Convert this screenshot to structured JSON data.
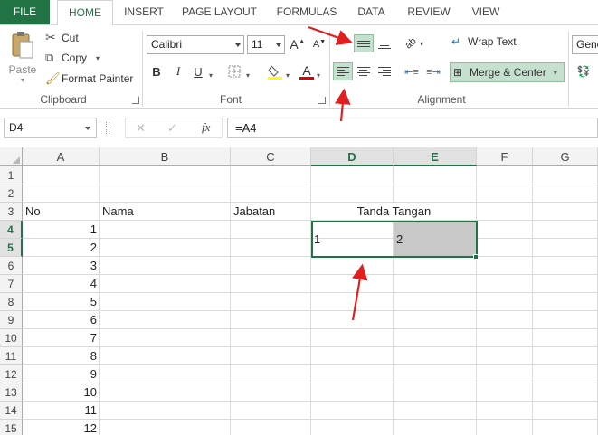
{
  "tabs": [
    "FILE",
    "HOME",
    "INSERT",
    "PAGE LAYOUT",
    "FORMULAS",
    "DATA",
    "REVIEW",
    "VIEW"
  ],
  "clipboard": {
    "paste": "Paste",
    "cut": "Cut",
    "copy": "Copy",
    "format_painter": "Format Painter",
    "label": "Clipboard"
  },
  "font": {
    "name": "Calibri",
    "size": "11",
    "label": "Font",
    "bold": "B",
    "italic": "I",
    "underline": "U",
    "grow": "A",
    "shrink": "A",
    "font_color": "A"
  },
  "alignment": {
    "wrap_text": "Wrap Text",
    "merge_center": "Merge & Center",
    "label": "Alignment"
  },
  "number": {
    "format": "Gene"
  },
  "formula_bar": {
    "name_box": "D4",
    "cancel": "✕",
    "enter": "✓",
    "fx": "fx",
    "formula": "=A4"
  },
  "columns": [
    "A",
    "B",
    "C",
    "D",
    "E",
    "F",
    "G"
  ],
  "rows": [
    "1",
    "2",
    "3",
    "4",
    "5",
    "6",
    "7",
    "8",
    "9",
    "10",
    "11",
    "12",
    "13",
    "14",
    "15"
  ],
  "cells": {
    "A3": "No",
    "B3": "Nama",
    "C3": "Jabatan",
    "D3": "Tanda Tangan",
    "A4": "1",
    "A5": "2",
    "A6": "3",
    "A7": "4",
    "A8": "5",
    "A9": "6",
    "A10": "7",
    "A11": "8",
    "A12": "9",
    "A13": "10",
    "A14": "11",
    "A15": "12",
    "D4": "1",
    "E4": "2"
  },
  "colors": {
    "accent": "#217346",
    "highlight": "#c6e0cf",
    "selected_cell_fill": "#c8c8c8",
    "annotation_arrow": "#e02020"
  }
}
